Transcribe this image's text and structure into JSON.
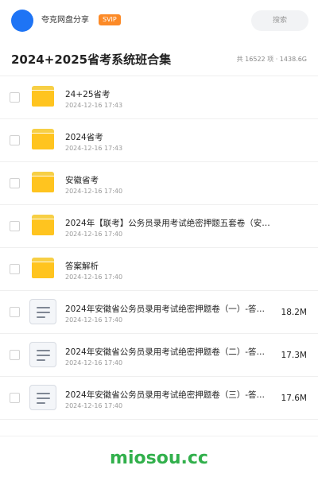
{
  "header": {
    "username": "夸克网盘分享",
    "badge": "SVIP",
    "search_placeholder": "搜索"
  },
  "title_bar": {
    "title": "2024+2025省考系统班合集",
    "summary": "共 16522 项 · 1438.6G"
  },
  "items": [
    {
      "type": "folder",
      "icon": "folder-icon",
      "name": "24+25省考",
      "date": "2024-12-16 17:43",
      "size": ""
    },
    {
      "type": "folder",
      "icon": "folder-icon",
      "name": "2024省考",
      "date": "2024-12-16 17:43",
      "size": ""
    },
    {
      "type": "folder",
      "icon": "folder-icon",
      "name": "安徽省考",
      "date": "2024-12-16 17:40",
      "size": ""
    },
    {
      "type": "folder",
      "icon": "folder-icon",
      "name": "2024年【联考】公务员录用考试绝密押题五套卷（安…",
      "date": "2024-12-16 17:40",
      "size": ""
    },
    {
      "type": "folder",
      "icon": "folder-icon",
      "name": "答案解析",
      "date": "2024-12-16 17:40",
      "size": ""
    },
    {
      "type": "file",
      "icon": "document-icon",
      "name": "2024年安徽省公务员录用考试绝密押题卷（一）-答…",
      "date": "2024-12-16 17:40",
      "size": "18.2M"
    },
    {
      "type": "file",
      "icon": "document-icon",
      "name": "2024年安徽省公务员录用考试绝密押题卷（二）-答…",
      "date": "2024-12-16 17:40",
      "size": "17.3M"
    },
    {
      "type": "file",
      "icon": "document-icon",
      "name": "2024年安徽省公务员录用考试绝密押题卷（三）-答…",
      "date": "2024-12-16 17:40",
      "size": "17.6M"
    }
  ],
  "footer": {
    "watermark": "miosou.cc"
  },
  "colors": {
    "avatar": "#1e74f5",
    "badge": "#fc8a27",
    "folder": "#ffc41f",
    "brand": "#32b04c"
  }
}
